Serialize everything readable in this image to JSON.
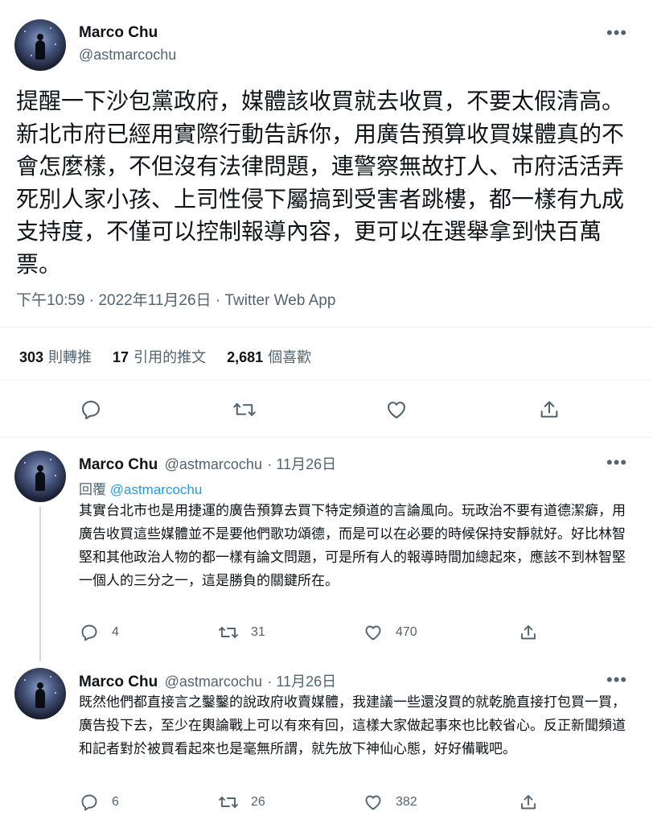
{
  "main_tweet": {
    "author_name": "Marco Chu",
    "author_handle": "@astmarcochu",
    "more_label": "•••",
    "text": "提醒一下沙包黨政府，媒體該收買就去收買，不要太假清高。新北市府已經用實際行動告訴你，用廣告預算收買媒體真的不會怎麼樣，不但沒有法律問題，連警察無故打人、市府活活弄死別人家小孩、上司性侵下屬搞到受害者跳樓，都一樣有九成支持度，不僅可以控制報導內容，更可以在選舉拿到快百萬票。",
    "timestamp": "下午10:59 · 2022年11月26日 · Twitter Web App",
    "stats": {
      "retweets_count": "303",
      "retweets_label": "則轉推",
      "quotes_count": "17",
      "quotes_label": "引用的推文",
      "likes_count": "2,681",
      "likes_label": "個喜歡"
    },
    "actions": [
      "reply-icon",
      "retweet-icon",
      "like-icon",
      "share-icon"
    ]
  },
  "replies": [
    {
      "author_name": "Marco Chu",
      "author_handle": "@astmarcochu",
      "date": "· 11月26日",
      "more_label": "•••",
      "replying_prefix": "回覆",
      "replying_handle": "@astmarcochu",
      "text": "其實台北市也是用捷運的廣告預算去買下特定頻道的言論風向。玩政治不要有道德潔癖，用廣告收買這些媒體並不是要他們歌功頌德，而是可以在必要的時候保持安靜就好。好比林智堅和其他政治人物的都一樣有論文問題，可是所有人的報導時間加總起來，應該不到林智堅一個人的三分之一，這是勝負的關鍵所在。",
      "reply_count": "4",
      "retweet_count": "31",
      "like_count": "470"
    },
    {
      "author_name": "Marco Chu",
      "author_handle": "@astmarcochu",
      "date": "· 11月26日",
      "more_label": "•••",
      "text": "既然他們都直接言之鑿鑿的說政府收賣媒體，我建議一些還沒買的就乾脆直接打包買一買，廣告投下去，至少在輿論戰上可以有來有回，這樣大家做起事來也比較省心。反正新聞頻道和記者對於被買看起來也是毫無所謂，就先放下神仙心態，好好備戰吧。",
      "reply_count": "6",
      "retweet_count": "26",
      "like_count": "382"
    }
  ],
  "colors": {
    "text": "#0f1419",
    "secondary": "#536471",
    "link": "#1d9bf0",
    "divider": "#eff3f4"
  }
}
